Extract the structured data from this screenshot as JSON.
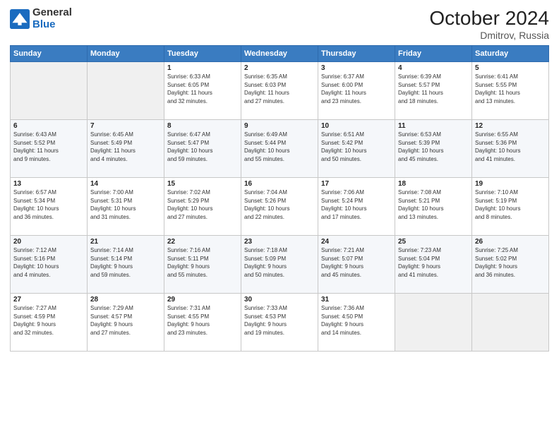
{
  "header": {
    "logo_line1": "General",
    "logo_line2": "Blue",
    "month": "October 2024",
    "location": "Dmitrov, Russia"
  },
  "weekdays": [
    "Sunday",
    "Monday",
    "Tuesday",
    "Wednesday",
    "Thursday",
    "Friday",
    "Saturday"
  ],
  "weeks": [
    [
      {
        "day": "",
        "detail": ""
      },
      {
        "day": "",
        "detail": ""
      },
      {
        "day": "1",
        "detail": "Sunrise: 6:33 AM\nSunset: 6:05 PM\nDaylight: 11 hours\nand 32 minutes."
      },
      {
        "day": "2",
        "detail": "Sunrise: 6:35 AM\nSunset: 6:03 PM\nDaylight: 11 hours\nand 27 minutes."
      },
      {
        "day": "3",
        "detail": "Sunrise: 6:37 AM\nSunset: 6:00 PM\nDaylight: 11 hours\nand 23 minutes."
      },
      {
        "day": "4",
        "detail": "Sunrise: 6:39 AM\nSunset: 5:57 PM\nDaylight: 11 hours\nand 18 minutes."
      },
      {
        "day": "5",
        "detail": "Sunrise: 6:41 AM\nSunset: 5:55 PM\nDaylight: 11 hours\nand 13 minutes."
      }
    ],
    [
      {
        "day": "6",
        "detail": "Sunrise: 6:43 AM\nSunset: 5:52 PM\nDaylight: 11 hours\nand 9 minutes."
      },
      {
        "day": "7",
        "detail": "Sunrise: 6:45 AM\nSunset: 5:49 PM\nDaylight: 11 hours\nand 4 minutes."
      },
      {
        "day": "8",
        "detail": "Sunrise: 6:47 AM\nSunset: 5:47 PM\nDaylight: 10 hours\nand 59 minutes."
      },
      {
        "day": "9",
        "detail": "Sunrise: 6:49 AM\nSunset: 5:44 PM\nDaylight: 10 hours\nand 55 minutes."
      },
      {
        "day": "10",
        "detail": "Sunrise: 6:51 AM\nSunset: 5:42 PM\nDaylight: 10 hours\nand 50 minutes."
      },
      {
        "day": "11",
        "detail": "Sunrise: 6:53 AM\nSunset: 5:39 PM\nDaylight: 10 hours\nand 45 minutes."
      },
      {
        "day": "12",
        "detail": "Sunrise: 6:55 AM\nSunset: 5:36 PM\nDaylight: 10 hours\nand 41 minutes."
      }
    ],
    [
      {
        "day": "13",
        "detail": "Sunrise: 6:57 AM\nSunset: 5:34 PM\nDaylight: 10 hours\nand 36 minutes."
      },
      {
        "day": "14",
        "detail": "Sunrise: 7:00 AM\nSunset: 5:31 PM\nDaylight: 10 hours\nand 31 minutes."
      },
      {
        "day": "15",
        "detail": "Sunrise: 7:02 AM\nSunset: 5:29 PM\nDaylight: 10 hours\nand 27 minutes."
      },
      {
        "day": "16",
        "detail": "Sunrise: 7:04 AM\nSunset: 5:26 PM\nDaylight: 10 hours\nand 22 minutes."
      },
      {
        "day": "17",
        "detail": "Sunrise: 7:06 AM\nSunset: 5:24 PM\nDaylight: 10 hours\nand 17 minutes."
      },
      {
        "day": "18",
        "detail": "Sunrise: 7:08 AM\nSunset: 5:21 PM\nDaylight: 10 hours\nand 13 minutes."
      },
      {
        "day": "19",
        "detail": "Sunrise: 7:10 AM\nSunset: 5:19 PM\nDaylight: 10 hours\nand 8 minutes."
      }
    ],
    [
      {
        "day": "20",
        "detail": "Sunrise: 7:12 AM\nSunset: 5:16 PM\nDaylight: 10 hours\nand 4 minutes."
      },
      {
        "day": "21",
        "detail": "Sunrise: 7:14 AM\nSunset: 5:14 PM\nDaylight: 9 hours\nand 59 minutes."
      },
      {
        "day": "22",
        "detail": "Sunrise: 7:16 AM\nSunset: 5:11 PM\nDaylight: 9 hours\nand 55 minutes."
      },
      {
        "day": "23",
        "detail": "Sunrise: 7:18 AM\nSunset: 5:09 PM\nDaylight: 9 hours\nand 50 minutes."
      },
      {
        "day": "24",
        "detail": "Sunrise: 7:21 AM\nSunset: 5:07 PM\nDaylight: 9 hours\nand 45 minutes."
      },
      {
        "day": "25",
        "detail": "Sunrise: 7:23 AM\nSunset: 5:04 PM\nDaylight: 9 hours\nand 41 minutes."
      },
      {
        "day": "26",
        "detail": "Sunrise: 7:25 AM\nSunset: 5:02 PM\nDaylight: 9 hours\nand 36 minutes."
      }
    ],
    [
      {
        "day": "27",
        "detail": "Sunrise: 7:27 AM\nSunset: 4:59 PM\nDaylight: 9 hours\nand 32 minutes."
      },
      {
        "day": "28",
        "detail": "Sunrise: 7:29 AM\nSunset: 4:57 PM\nDaylight: 9 hours\nand 27 minutes."
      },
      {
        "day": "29",
        "detail": "Sunrise: 7:31 AM\nSunset: 4:55 PM\nDaylight: 9 hours\nand 23 minutes."
      },
      {
        "day": "30",
        "detail": "Sunrise: 7:33 AM\nSunset: 4:53 PM\nDaylight: 9 hours\nand 19 minutes."
      },
      {
        "day": "31",
        "detail": "Sunrise: 7:36 AM\nSunset: 4:50 PM\nDaylight: 9 hours\nand 14 minutes."
      },
      {
        "day": "",
        "detail": ""
      },
      {
        "day": "",
        "detail": ""
      }
    ]
  ]
}
